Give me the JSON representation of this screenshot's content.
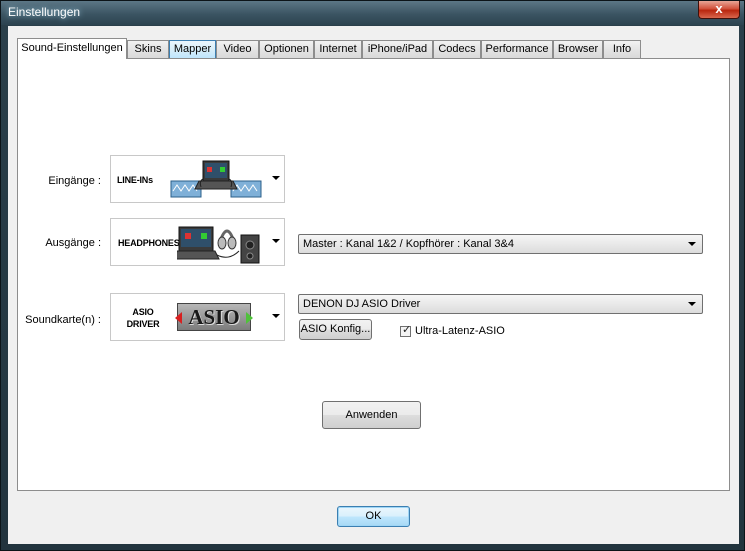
{
  "window": {
    "title": "Einstellungen",
    "close_glyph": "x"
  },
  "tabs": [
    {
      "label": "Sound-Einstellungen",
      "active": true
    },
    {
      "label": "Skins"
    },
    {
      "label": "Mapper",
      "hover": true
    },
    {
      "label": "Video"
    },
    {
      "label": "Optionen"
    },
    {
      "label": "Internet"
    },
    {
      "label": "iPhone/iPad"
    },
    {
      "label": "Codecs"
    },
    {
      "label": "Performance"
    },
    {
      "label": "Browser"
    },
    {
      "label": "Info"
    }
  ],
  "inputs": {
    "label": "Eingänge :",
    "image_text": "LINE-INs",
    "image_icon": "line-in-laptop-icon"
  },
  "outputs": {
    "label": "Ausgänge :",
    "image_text": "HEADPHONES",
    "image_icon": "headphones-laptop-speaker-icon",
    "selected": "Master : Kanal 1&2 / Kopfhörer : Kanal 3&4"
  },
  "soundcard": {
    "label": "Soundkarte(n) :",
    "image_text_1": "ASIO",
    "image_text_2": "DRIVER",
    "logo_text": "ASIO",
    "selected": "DENON DJ ASIO Driver",
    "config_button": "ASIO Konfig...",
    "ultra_latency_label": "Ultra-Latenz-ASIO",
    "ultra_latency_checked": true,
    "check_glyph": "✓"
  },
  "apply_button": "Anwenden",
  "ok_button": "OK",
  "colors": {
    "accent": "#3c7fb1",
    "asio_red": "#d81f1f",
    "asio_green": "#4fc23a"
  }
}
